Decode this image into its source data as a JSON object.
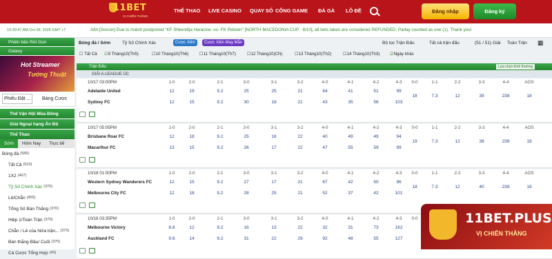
{
  "header": {
    "logo": "11BET",
    "logo_sub": "VỊ CHIẾN THẮNG",
    "nav": [
      "THỂ THAO",
      "LIVE CASINO",
      "QUAY SỐ",
      "CỔNG GAME",
      "ĐÁ GÀ",
      "LÔ ĐỀ"
    ],
    "login": "Đăng nhập",
    "register": "Đăng ký"
  },
  "ticker": {
    "time": "10:39:47 AM Oct 09, 2025 GMT +7",
    "message": "Attn:[Soccer] Due to match postponed \"KF Shkendija Haracine -vs- FK Pelister\" [NORTH MACEDONIA CUP - 8/10], all bets taken are considered REFUNDED; Parlay counted as one (1). Thank you!"
  },
  "sidebar": {
    "promo1": "Phiên bản Rút Gọn",
    "promo2": "Galaxy",
    "banner_a": "Hot Streamer",
    "banner_b": "Tướng Thuật",
    "tab_select": "Phiếu Đặt ...",
    "tab_right": "Bảng Cược",
    "groups": [
      "Thế Vận Hội Mùa Đông",
      "Giải Ngoại hạng Ấn Độ"
    ],
    "sports": "Thể Thao",
    "subtabs": [
      "Sớm",
      "Hôm Nay",
      "Trực tiế"
    ],
    "items": [
      {
        "label": "Bóng đá",
        "count": "(589)"
      },
      {
        "label": "Tất Cả",
        "count": "(510)"
      },
      {
        "label": "1X2",
        "count": "(467)"
      },
      {
        "label": "Tỷ Số Chính Xác",
        "count": "(370)"
      },
      {
        "label": "Lẻ/Chẵn",
        "count": "(455)"
      },
      {
        "label": "Tổng Số Bàn Thắng",
        "count": "(370)"
      },
      {
        "label": "Hiệp 1/Toàn Trận",
        "count": "(370)"
      },
      {
        "label": "Chẵn / Lẻ của Nửa trận...",
        "count": "(370)"
      },
      {
        "label": "Bàn thắng Đầu/ Cuối",
        "count": "(370)"
      },
      {
        "label": "Cá Cược Tổng Hợp",
        "count": "(40)"
      }
    ]
  },
  "main": {
    "sport_label": "Bóng đá / Sớm",
    "market_select": "Tỷ Số Chính Xác",
    "chip1": "Cược Xiên",
    "chip2": "Cược Xiên May Mắn",
    "filter_league": "Bộ lọc Trận Đấu",
    "filter_all": "Tất cả trận đấu",
    "count": "(51 / 51) Giải",
    "full_time": "Toàn Trận",
    "days": [
      {
        "label": "Tất Cả",
        "checked": false
      },
      {
        "label": "9 Tháng10(Th5)",
        "checked": true
      },
      {
        "label": "10 Tháng10(Th6)",
        "checked": false
      },
      {
        "label": "11 Tháng10(Th7)",
        "checked": false
      },
      {
        "label": "12 Tháng10(CN)",
        "checked": false
      },
      {
        "label": "13 Tháng10(Th2)",
        "checked": false
      },
      {
        "label": "14 Tháng10(Th3)",
        "checked": false
      },
      {
        "label": "Ngày khác",
        "checked": true
      }
    ],
    "section": "Trận Đấu",
    "sort": "Lựa chọn bình thường",
    "league": "GIẢI A-LEAGUE ÚC",
    "cols_home": [
      "1-0",
      "2-0",
      "2-1",
      "3-0",
      "3-1",
      "3-2",
      "4-0",
      "4-1",
      "4-2",
      "4-3"
    ],
    "cols_draw": [
      "0-0",
      "1-1",
      "2-2",
      "3-3",
      "4-4",
      "AOS"
    ],
    "matches": [
      {
        "time": "10/17 03:00PM",
        "home": "Adelaide United",
        "away": "Sydney FC",
        "home_odds": [
          "12",
          "19",
          "9.2",
          "25",
          "25",
          "21",
          "64",
          "41",
          "51",
          "99"
        ],
        "away_odds": [
          "12",
          "15",
          "9.2",
          "30",
          "18",
          "21",
          "43",
          "35",
          "56",
          "103"
        ],
        "draw": [
          "18",
          "7.3",
          "12",
          "39",
          "238",
          "18"
        ]
      },
      {
        "time": "10/17 05:05PM",
        "home": "Brisbane Roar FC",
        "away": "Macarthur FC",
        "home_odds": [
          "12",
          "18",
          "9.2",
          "25",
          "16",
          "22",
          "40",
          "49",
          "49",
          "94"
        ],
        "away_odds": [
          "13",
          "15",
          "9.2",
          "26",
          "17",
          "22",
          "47",
          "55",
          "59",
          "99"
        ],
        "draw": [
          "19",
          "7.3",
          "12",
          "38",
          "238",
          "18"
        ]
      },
      {
        "time": "10/18 01:00PM",
        "home": "Western Sydney Wanderers FC",
        "away": "Melbourne City FC",
        "home_odds": [
          "12",
          "15",
          "9.2",
          "27",
          "17",
          "21",
          "67",
          "42",
          "50",
          "96"
        ],
        "away_odds": [
          "12",
          "18",
          "9.2",
          "28",
          "25",
          "21",
          "52",
          "37",
          "42",
          "101"
        ],
        "draw": [
          "18",
          "7.3",
          "12",
          "40",
          "238",
          "18"
        ]
      },
      {
        "time": "10/18 03:35PM",
        "home": "Melbourne Victory",
        "away": "Auckland FC",
        "home_odds": [
          "8.8",
          "12",
          "9.2",
          "16",
          "13",
          "22",
          "32",
          "31",
          "73",
          "162"
        ],
        "away_odds": [
          "9.6",
          "14",
          "9.2",
          "31",
          "22",
          "29",
          "92",
          "48",
          "55",
          "127"
        ],
        "draw": [
          "",
          "",
          "",
          "",
          "",
          ""
        ]
      }
    ]
  },
  "watermark": {
    "a": "11BET.PLUS",
    "b": "VỊ CHIẾN THẮNG"
  }
}
